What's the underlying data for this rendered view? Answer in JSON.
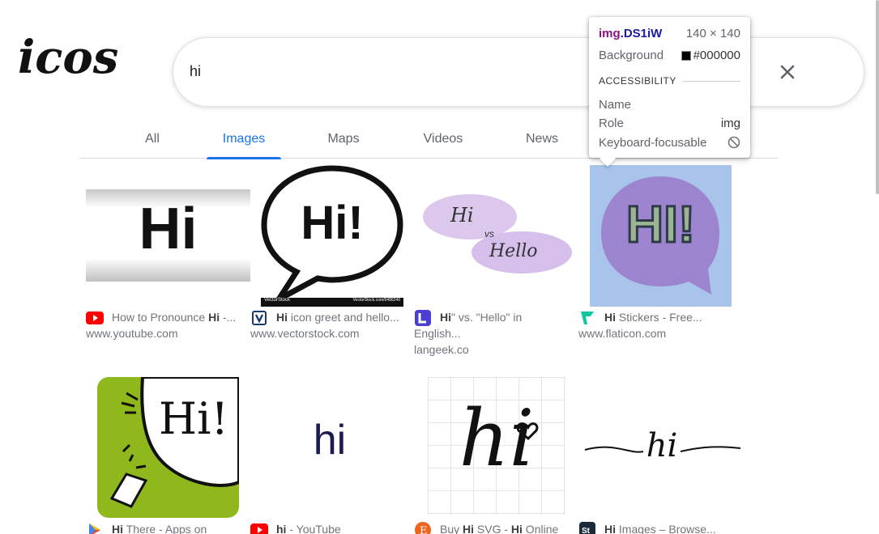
{
  "logo": {
    "text": "icos"
  },
  "search": {
    "value": "hi"
  },
  "tabs": [
    "All",
    "Images",
    "Maps",
    "Videos",
    "News"
  ],
  "colors": {
    "accent": "#1a73e8",
    "muted": "#70757a",
    "youtube": "#ff0000"
  },
  "results": [
    {
      "title_bold": "Hi",
      "title_rest": "How to Pronounce Hi -...",
      "pre": "How to Pronounce ",
      "post": " -...",
      "host": "www.youtube.com",
      "icon": "youtube-icon",
      "thumb_text": "Hi"
    },
    {
      "pre": "",
      "bold": "Hi",
      "post": " icon greet and hello...",
      "host": "www.vectorstock.com",
      "icon": "vectorstock-icon",
      "thumb_text": "Hi!",
      "thumb_small_left": "VectorStock",
      "thumb_small_right": "VectorStock.com/6486240"
    },
    {
      "pre": "",
      "bold": "Hi",
      "post": "\" vs. \"Hello\" in",
      "line2": "English...",
      "host": "langeek.co",
      "icon": "langeek-icon",
      "thumb_text_a": "Hi",
      "thumb_text_b": "vs",
      "thumb_text_c": "Hello"
    },
    {
      "pre": "",
      "bold": "Hi",
      "post": " Stickers - Free...",
      "host": "www.flaticon.com",
      "icon": "flaticon-icon",
      "thumb_text": "HI!"
    },
    {
      "pre": "",
      "bold": "Hi",
      "post": " There - Apps on",
      "icon": "google-play-icon",
      "thumb_text": "Hi!"
    },
    {
      "pre": "",
      "bold": "hi",
      "post": " - YouTube",
      "icon": "youtube-icon",
      "thumb_text": "hi"
    },
    {
      "pre": "Buy ",
      "bold": "Hi",
      "mid": " SVG - ",
      "bold2": "Hi",
      "post": " Online",
      "icon": "etsy-icon",
      "thumb_text": "hi"
    },
    {
      "pre": "",
      "bold": "Hi",
      "post": " Images – Browse...",
      "icon": "shutterstock-icon",
      "thumb_text": "hi"
    }
  ],
  "inspector": {
    "selector_tag": "img",
    "selector_class": ".DS1iW",
    "dims": "140 × 140",
    "background_label": "Background",
    "background_value": "#000000",
    "section": "ACCESSIBILITY",
    "name_label": "Name",
    "name_value": "",
    "role_label": "Role",
    "role_value": "img",
    "focus_label": "Keyboard-focusable"
  }
}
